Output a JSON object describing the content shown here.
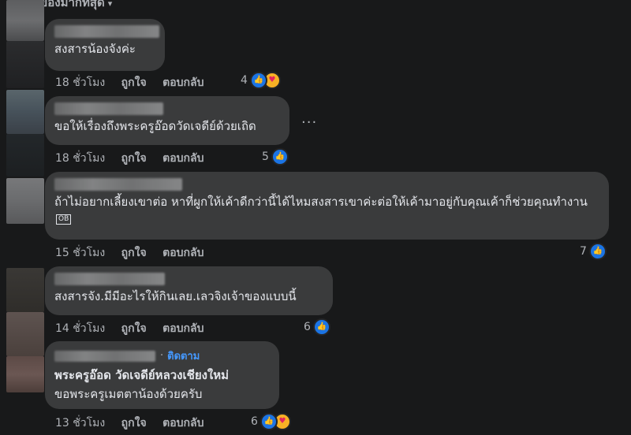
{
  "header": {
    "sort_label": "ของมากที่สุด"
  },
  "comments": [
    {
      "text": "สงสารน้องจังค่ะ",
      "time": "18 ชั่วโมง",
      "like": "ถูกใจ",
      "reply": "ตอบกลับ",
      "reaction_count": "4",
      "reactions": [
        "like-icon",
        "care-icon"
      ]
    },
    {
      "text": "ขอให้เรื่องถึงพระครูอ๊อดวัดเจดีย์ด้วยเถิด",
      "time": "18 ชั่วโมง",
      "like": "ถูกใจ",
      "reply": "ตอบกลับ",
      "reaction_count": "5",
      "reactions": [
        "like-icon"
      ],
      "more": "..."
    },
    {
      "text": "ถ้าไม่อยากเลี้ยงเขาต่อ หาที่ผูกให้เค้าดีกว่านี้ได้ไหมสงสารเขาค่ะต่อให้เค้ามาอยู่กับคุณเค้าก็ช่วยคุณทำงาน",
      "text_tail": "OB",
      "time": "15 ชั่วโมง",
      "like": "ถูกใจ",
      "reply": "ตอบกลับ",
      "reaction_count": "7",
      "reactions": [
        "like-icon"
      ]
    },
    {
      "text": "สงสารจัง.มีมีอะไรให้กินเลย.เลวจิงเจ้าของแบบนี้",
      "time": "14 ชั่วโมง",
      "like": "ถูกใจ",
      "reply": "ตอบกลับ",
      "reaction_count": "6",
      "reactions": [
        "like-icon"
      ]
    },
    {
      "follow_sep": "·",
      "follow": "ติดตาม",
      "text": "พระครูอ๊อด วัดเจดีย์หลวงเชียงใหม่",
      "text2": "ขอพระครูเมตตาน้องด้วยครับ",
      "time": "13 ชั่วโมง",
      "like": "ถูกใจ",
      "reply": "ตอบกลับ",
      "reaction_count": "6",
      "reactions": [
        "like-icon",
        "care-icon"
      ]
    }
  ],
  "colors": {
    "background": "#18191a",
    "bubble": "#3a3b3c",
    "text": "#e4e6eb",
    "muted": "#b0b3b8",
    "link": "#4599ff",
    "like": "#1b74e4",
    "care": "#f7b125"
  }
}
